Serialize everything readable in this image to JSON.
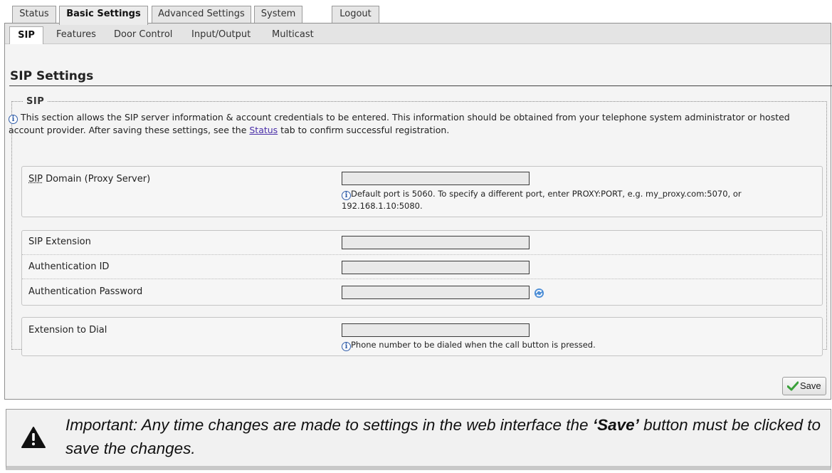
{
  "top_tabs": [
    "Status",
    "Basic Settings",
    "Advanced Settings",
    "System",
    "Logout"
  ],
  "sub_tabs": [
    "SIP",
    "Features",
    "Door Control",
    "Input/Output",
    "Multicast"
  ],
  "page_title": "SIP Settings",
  "section_legend": "SIP",
  "intro": {
    "before_link": "This section allows the SIP server information & account credentials to be entered. This information should be obtained from your telephone system administrator or hosted account provider. After saving these settings, see the ",
    "link": "Status",
    "after_link": " tab to confirm successful registration."
  },
  "fields": {
    "sip_domain": {
      "label_abbr": "SIP",
      "label_rest": " Domain (Proxy Server)",
      "value": "",
      "hint": "Default port is 5060. To specify a different port, enter PROXY:PORT, e.g. my_proxy.com:5070, or 192.168.1.10:5080."
    },
    "sip_extension": {
      "label": "SIP Extension",
      "value": ""
    },
    "auth_id": {
      "label": "Authentication ID",
      "value": ""
    },
    "auth_password": {
      "label": "Authentication Password",
      "value": ""
    },
    "extension_to_dial": {
      "label": "Extension to Dial",
      "value": "",
      "hint": "Phone number to be dialed when the call button is pressed."
    }
  },
  "save_label": "Save",
  "note": {
    "before": "Important: Any time changes are made to settings in the web interface the ",
    "bold": "‘Save’",
    "after": " button must be clicked to save the changes."
  },
  "icons": {
    "info": "info-icon",
    "refresh": "refresh-icon",
    "save_check": "checkmark-icon",
    "warning": "warning-icon"
  },
  "colors": {
    "link": "#4a2fa8",
    "info": "#2f5ca8",
    "check": "#3aa13a"
  }
}
